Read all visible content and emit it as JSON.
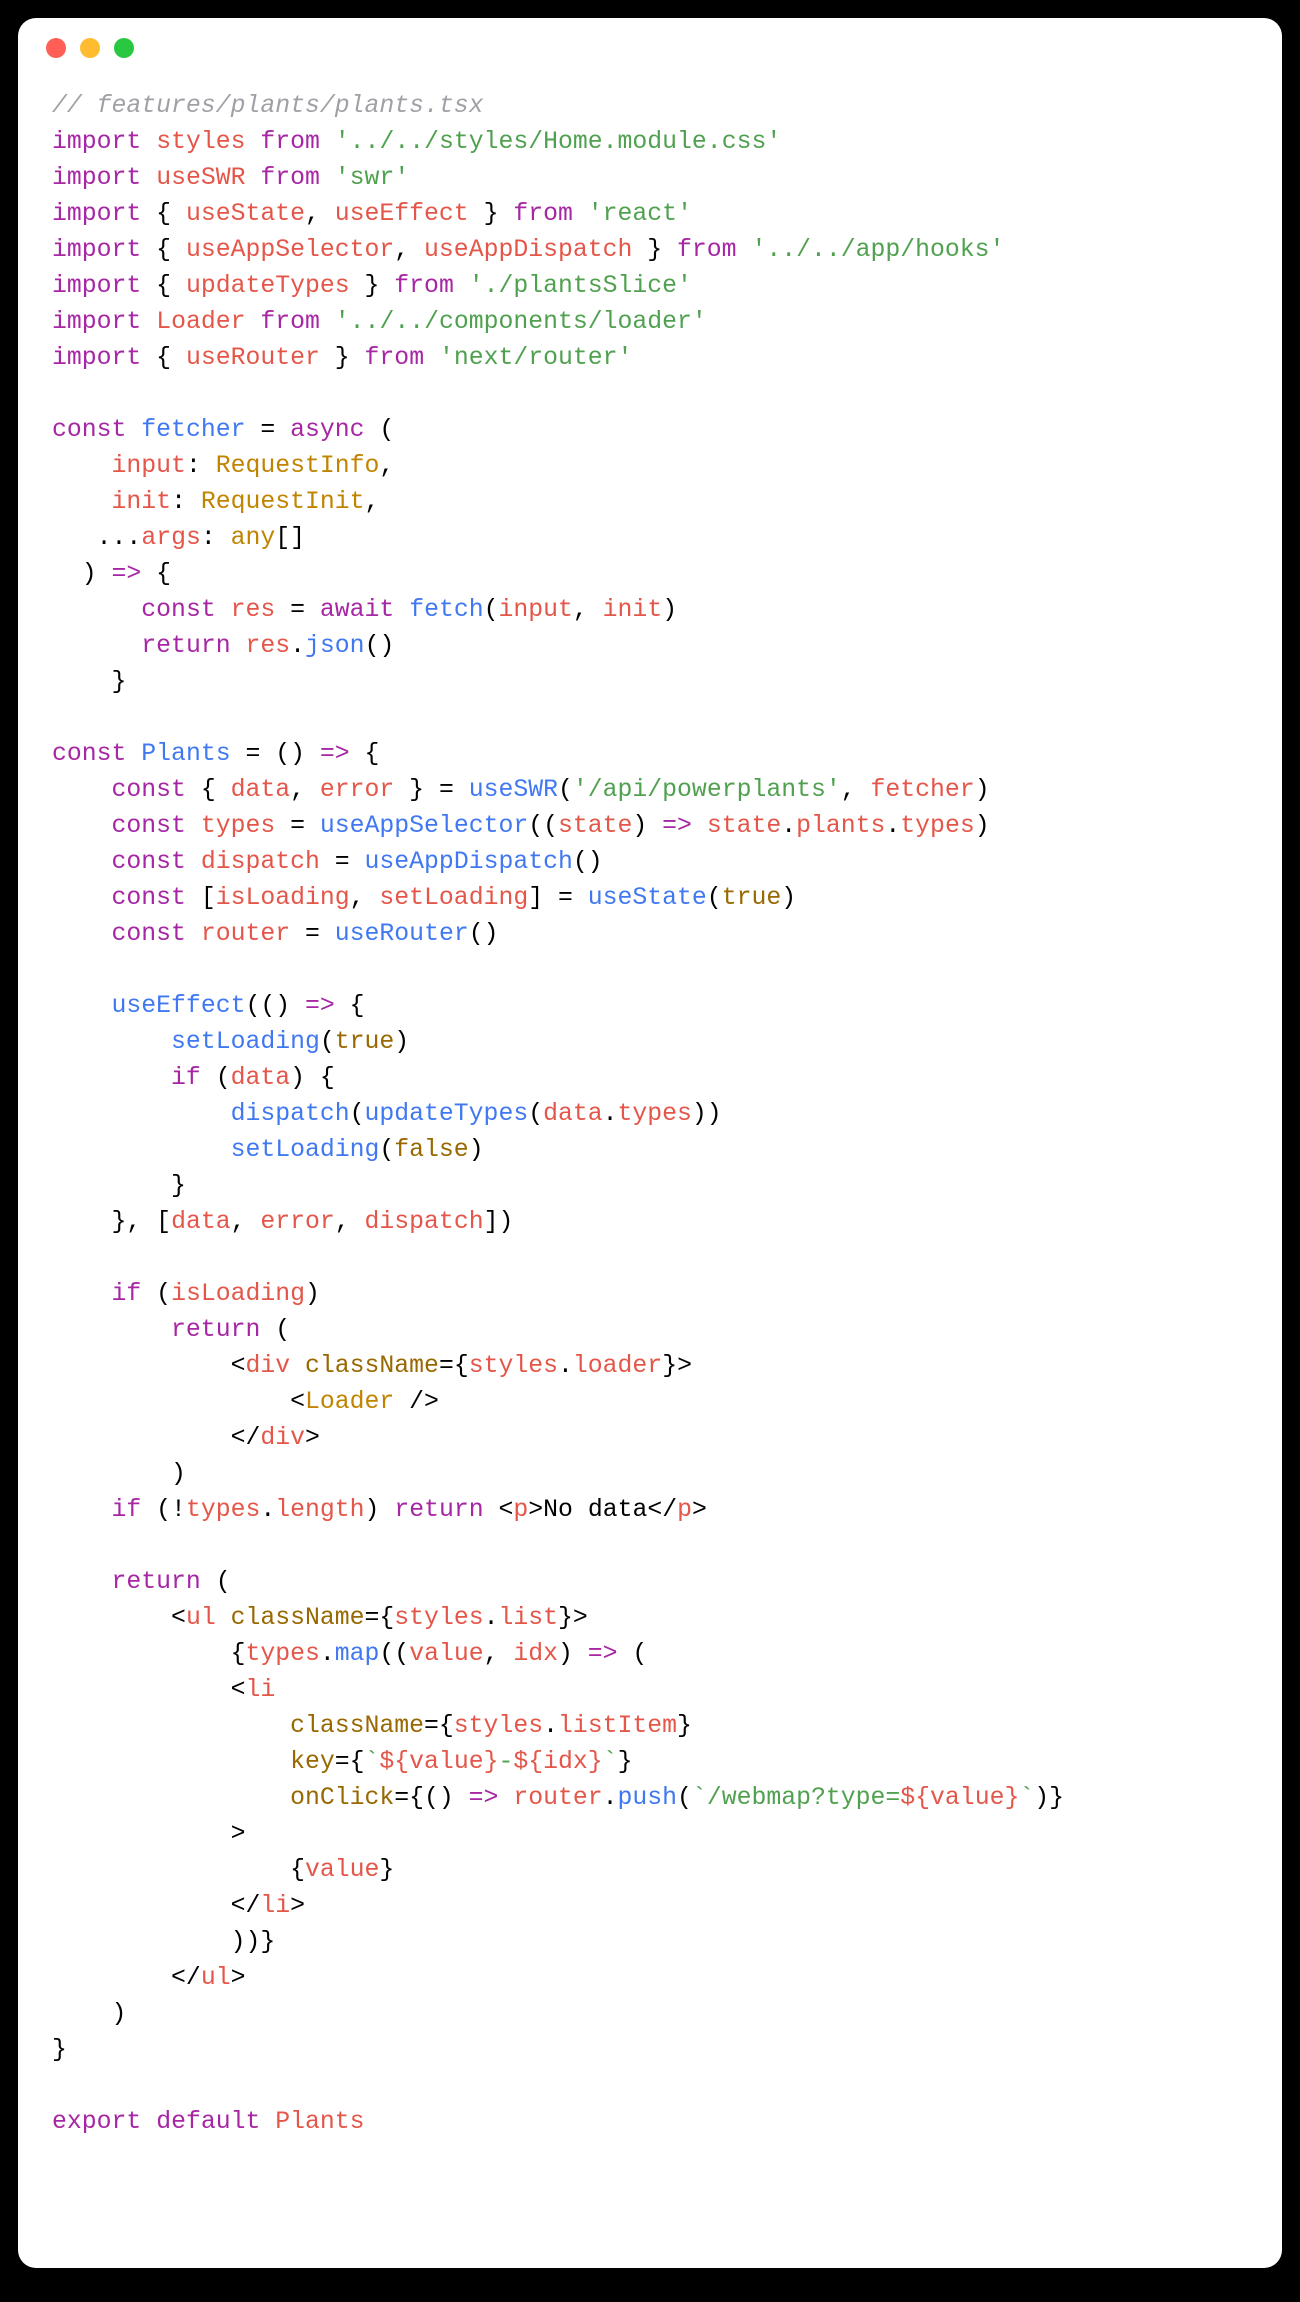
{
  "window": {
    "close_color": "#ff5f57",
    "minimize_color": "#febc2e",
    "maximize_color": "#28c840"
  },
  "code": {
    "comment_path": "// features/plants/plants.tsx",
    "imp1_kw_import": "import",
    "imp1_ident": "styles",
    "imp1_kw_from": "from",
    "imp1_str": "'../../styles/Home.module.css'",
    "imp2_kw_import": "import",
    "imp2_ident": "useSWR",
    "imp2_kw_from": "from",
    "imp2_str": "'swr'",
    "imp3_kw_import": "import",
    "imp3_open": " { ",
    "imp3_a": "useState",
    "imp3_comma": ", ",
    "imp3_b": "useEffect",
    "imp3_close": " } ",
    "imp3_kw_from": "from",
    "imp3_str": "'react'",
    "imp4_kw_import": "import",
    "imp4_open": " { ",
    "imp4_a": "useAppSelector",
    "imp4_comma": ", ",
    "imp4_b": "useAppDispatch",
    "imp4_close": " } ",
    "imp4_kw_from": "from",
    "imp4_str": "'../../app/hooks'",
    "imp5_kw_import": "import",
    "imp5_open": " { ",
    "imp5_a": "updateTypes",
    "imp5_close": " } ",
    "imp5_kw_from": "from",
    "imp5_str": "'./plantsSlice'",
    "imp6_kw_import": "import",
    "imp6_ident": "Loader",
    "imp6_kw_from": "from",
    "imp6_str": "'../../components/loader'",
    "imp7_kw_import": "import",
    "imp7_open": " { ",
    "imp7_a": "useRouter",
    "imp7_close": " } ",
    "imp7_kw_from": "from",
    "imp7_str": "'next/router'",
    "fetcher_const": "const",
    "fetcher_name": "fetcher",
    "fetcher_eq": " = ",
    "fetcher_async": "async",
    "fetcher_open": " (",
    "fetcher_p1_name": "input",
    "fetcher_p1_colon": ": ",
    "fetcher_p1_type": "RequestInfo",
    "fetcher_p1_comma": ",",
    "fetcher_p2_name": "init",
    "fetcher_p2_colon": ": ",
    "fetcher_p2_type": "RequestInit",
    "fetcher_p2_comma": ",",
    "fetcher_p3_rest": "...",
    "fetcher_p3_name": "args",
    "fetcher_p3_colon": ": ",
    "fetcher_p3_type": "any",
    "fetcher_p3_brackets": "[]",
    "fetcher_paren_close": "  ) ",
    "fetcher_arrow": "=>",
    "fetcher_body_open": " {",
    "fetcher_b1_const": "const",
    "fetcher_b1_res": "res",
    "fetcher_b1_eq": " = ",
    "fetcher_b1_await": "await",
    "fetcher_b1_fetch": "fetch",
    "fetcher_b1_args_open": "(",
    "fetcher_b1_arg1": "input",
    "fetcher_b1_comma": ", ",
    "fetcher_b1_arg2": "init",
    "fetcher_b1_args_close": ")",
    "fetcher_b2_return": "return",
    "fetcher_b2_res": "res",
    "fetcher_b2_dot": ".",
    "fetcher_b2_json": "json",
    "fetcher_b2_call": "()",
    "fetcher_body_close": "}",
    "plants_const": "const",
    "plants_name": "Plants",
    "plants_eq": " = () ",
    "plants_arrow": "=>",
    "plants_body_open": " {",
    "l1_const": "const",
    "l1_open": " { ",
    "l1_data": "data",
    "l1_comma": ", ",
    "l1_error": "error",
    "l1_close": " } = ",
    "l1_useSWR": "useSWR",
    "l1_paren_open": "(",
    "l1_str": "'/api/powerplants'",
    "l1_comma2": ", ",
    "l1_fetcher": "fetcher",
    "l1_paren_close": ")",
    "l2_const": "const",
    "l2_types": "types",
    "l2_eq": " = ",
    "l2_fn": "useAppSelector",
    "l2_open": "((",
    "l2_state": "state",
    "l2_close": ") ",
    "l2_arrow": "=>",
    "l2_sp": " ",
    "l2_state2": "state",
    "l2_dot": ".",
    "l2_plants": "plants",
    "l2_dot2": ".",
    "l2_types2": "types",
    "l2_end": ")",
    "l3_const": "const",
    "l3_dispatch": "dispatch",
    "l3_eq": " = ",
    "l3_fn": "useAppDispatch",
    "l3_call": "()",
    "l4_const": "const",
    "l4_open": " [",
    "l4_a": "isLoading",
    "l4_comma": ", ",
    "l4_b": "setLoading",
    "l4_close": "] = ",
    "l4_fn": "useState",
    "l4_paren_open": "(",
    "l4_true": "true",
    "l4_paren_close": ")",
    "l5_const": "const",
    "l5_router": "router",
    "l5_eq": " = ",
    "l5_fn": "useRouter",
    "l5_call": "()",
    "ue_fn": "useEffect",
    "ue_open": "(() ",
    "ue_arrow": "=>",
    "ue_body_open": " {",
    "ue1_fn": "setLoading",
    "ue1_open": "(",
    "ue1_true": "true",
    "ue1_close": ")",
    "ue_if": "if",
    "ue_if_open": " (",
    "ue_if_data": "data",
    "ue_if_close": ") {",
    "ue2_fn": "dispatch",
    "ue2_open": "(",
    "ue2_upd": "updateTypes",
    "ue2_open2": "(",
    "ue2_data": "data",
    "ue2_dot": ".",
    "ue2_types": "types",
    "ue2_close": "))",
    "ue3_fn": "setLoading",
    "ue3_open": "(",
    "ue3_false": "false",
    "ue3_close": ")",
    "ue_if_body_close": "}",
    "ue_body_close": "}, [",
    "ue_dep1": "data",
    "ue_dep_c1": ", ",
    "ue_dep2": "error",
    "ue_dep_c2": ", ",
    "ue_dep3": "dispatch",
    "ue_deps_close": "])",
    "if1_if": "if",
    "if1_open": " (",
    "if1_cond": "isLoading",
    "if1_close": ")",
    "if1_return": "return",
    "if1_paren": " (",
    "if1_div_open_lt": "<",
    "if1_div_tag": "div",
    "if1_div_sp": " ",
    "if1_div_attr": "className",
    "if1_div_eq": "={",
    "if1_div_styles": "styles",
    "if1_div_dot": ".",
    "if1_div_loader": "loader",
    "if1_div_gt": "}>",
    "if1_loader_open": "<",
    "if1_loader_tag": "Loader",
    "if1_loader_close": " />",
    "if1_div_close_open": "</",
    "if1_div_close_tag": "div",
    "if1_div_close_gt": ">",
    "if1_paren_close": ")",
    "if2_if": "if",
    "if2_open": " (!",
    "if2_types": "types",
    "if2_dot": ".",
    "if2_length": "length",
    "if2_close": ") ",
    "if2_return": "return",
    "if2_sp": " ",
    "if2_p_open": "<",
    "if2_p_tag": "p",
    "if2_p_gt": ">",
    "if2_text": "No data",
    "if2_p_close_open": "</",
    "if2_p_close_tag": "p",
    "if2_p_close_gt": ">",
    "ret_return": "return",
    "ret_open": " (",
    "ret_ul_open": "<",
    "ret_ul_tag": "ul",
    "ret_ul_sp": " ",
    "ret_ul_attr": "className",
    "ret_ul_eq": "={",
    "ret_ul_styles": "styles",
    "ret_ul_dot": ".",
    "ret_ul_list": "list",
    "ret_ul_gt": "}>",
    "ret_map_open": "{",
    "ret_map_types": "types",
    "ret_map_dot": ".",
    "ret_map_fn": "map",
    "ret_map_paren": "((",
    "ret_map_value": "value",
    "ret_map_comma": ", ",
    "ret_map_idx": "idx",
    "ret_map_close": ") ",
    "ret_map_arrow": "=>",
    "ret_map_open2": " (",
    "ret_li_open": "<",
    "ret_li_tag": "li",
    "ret_li_attr1": "className",
    "ret_li_eq1": "={",
    "ret_li_styles": "styles",
    "ret_li_dot": ".",
    "ret_li_listItem": "listItem",
    "ret_li_close1": "}",
    "ret_li_attr2": "key",
    "ret_li_eq2": "={",
    "ret_li_tick1": "`",
    "ret_li_tmpl_open1": "${",
    "ret_li_value1": "value",
    "ret_li_tmpl_close1": "}",
    "ret_li_dash": "-",
    "ret_li_tmpl_open2": "${",
    "ret_li_idx": "idx",
    "ret_li_tmpl_close2": "}",
    "ret_li_tick2": "`",
    "ret_li_close2": "}",
    "ret_li_attr3": "onClick",
    "ret_li_eq3": "={() ",
    "ret_li_arrow": "=>",
    "ret_li_sp": " ",
    "ret_li_router": "router",
    "ret_li_dot2": ".",
    "ret_li_push": "push",
    "ret_li_push_open": "(",
    "ret_li_tick3": "`",
    "ret_li_url": "/webmap?type=",
    "ret_li_tmpl_open3": "${",
    "ret_li_value2": "value",
    "ret_li_tmpl_close3": "}",
    "ret_li_tick4": "`",
    "ret_li_push_close": ")}",
    "ret_li_gt": ">",
    "ret_li_child_open": "{",
    "ret_li_child": "value",
    "ret_li_child_close": "}",
    "ret_li_close_open": "</",
    "ret_li_close_tag": "li",
    "ret_li_close_gt": ">",
    "ret_map_close2": "))}",
    "ret_ul_close_open": "</",
    "ret_ul_close_tag": "ul",
    "ret_ul_close_gt": ">",
    "ret_close": ")",
    "plants_body_close": "}",
    "exp_export": "export",
    "exp_default": "default",
    "exp_plants": "Plants"
  }
}
